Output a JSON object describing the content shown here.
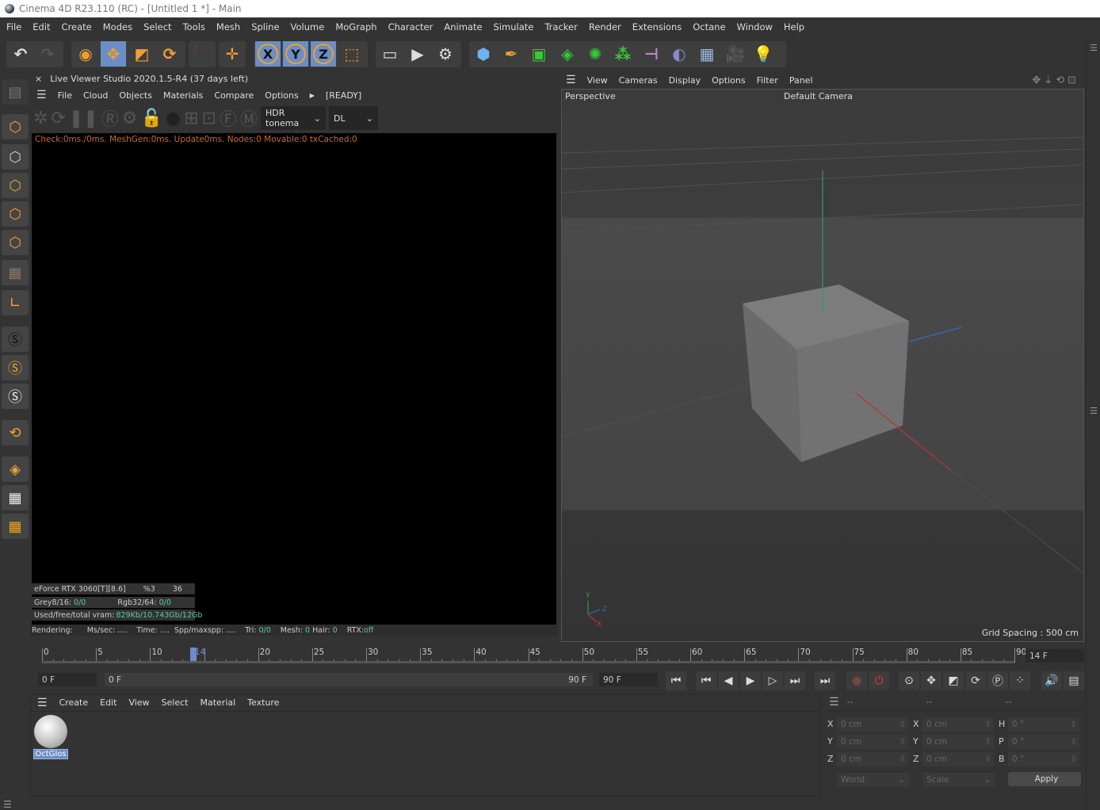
{
  "window": {
    "title": "Cinema 4D R23.110 (RC) - [Untitled 1 *] - Main"
  },
  "menu": [
    "File",
    "Edit",
    "Create",
    "Modes",
    "Select",
    "Tools",
    "Mesh",
    "Spline",
    "Volume",
    "MoGraph",
    "Character",
    "Animate",
    "Simulate",
    "Tracker",
    "Render",
    "Extensions",
    "Octane",
    "Window",
    "Help"
  ],
  "toolbar": {
    "axis_x": "X",
    "axis_y": "Y",
    "axis_z": "Z",
    "psr": "PSR"
  },
  "live_viewer": {
    "title": "Live Viewer Studio 2020.1.5-R4 (37 days left)",
    "menu": [
      "File",
      "Cloud",
      "Objects",
      "Materials",
      "Compare",
      "Options"
    ],
    "status": "[READY]",
    "tonemap": "HDR tonema",
    "kernel": "DL",
    "check": "Check:0ms./0ms. MeshGen:0ms. Update0ms. Nodes:0 Movable:0 txCached:0",
    "gpu": "eForce RTX 3060[T][8.6]",
    "gpu_pct": "%3",
    "gpu_temp": "36",
    "grey_label": "Grey8/16:",
    "grey_val": "0/0",
    "rgb_label": "Rgb32/64:",
    "rgb_val": "0/0",
    "vram_label": "Used/free/total vram:",
    "vram_val": "829Kb/10.743Gb/12Gb",
    "rendering": "Rendering:",
    "mssec": "Ms/sec: ....",
    "time": "Time: ....",
    "spp": "Spp/maxspp: ....",
    "tri_label": "Tri:",
    "tri": "0/0",
    "mesh_label": "Mesh:",
    "mesh": "0",
    "hair_label": "Hair:",
    "hair": "0",
    "rtx_label": "RTX:",
    "rtx": "off"
  },
  "viewport": {
    "menu": [
      "View",
      "Cameras",
      "Display",
      "Options",
      "Filter",
      "Panel"
    ],
    "projection": "Perspective",
    "camera": "Default Camera",
    "grid_spacing": "Grid Spacing : 500 cm",
    "axis_y": "Y",
    "axis_z": "Z",
    "axis_x": "X"
  },
  "timeline": {
    "ticks": [
      "0",
      "5",
      "10",
      "14",
      "20",
      "25",
      "30",
      "35",
      "40",
      "45",
      "50",
      "55",
      "60",
      "65",
      "70",
      "75",
      "80",
      "85",
      "90"
    ],
    "current_frame": 14,
    "current_field": "14 F",
    "start": "0 F",
    "range_start": "0 F",
    "range_end": "90 F",
    "end": "90 F"
  },
  "materials": {
    "menu": [
      "Create",
      "Edit",
      "View",
      "Select",
      "Material",
      "Texture"
    ],
    "items": [
      {
        "name": "OctGlos"
      }
    ]
  },
  "coords": {
    "headers": [
      "--",
      "--",
      "--"
    ],
    "rows": [
      [
        "X",
        "0 cm",
        "X",
        "0 cm",
        "H",
        "0 °"
      ],
      [
        "Y",
        "0 cm",
        "Y",
        "0 cm",
        "P",
        "0 °"
      ],
      [
        "Z",
        "0 cm",
        "Z",
        "0 cm",
        "B",
        "0 °"
      ]
    ],
    "space": "World",
    "mode": "Scale",
    "apply": "Apply"
  },
  "colors": {
    "accent": "#6b8ec6",
    "orange": "#f0a030",
    "green_stat": "#5ac8b0",
    "check_text": "#d06a1a"
  }
}
